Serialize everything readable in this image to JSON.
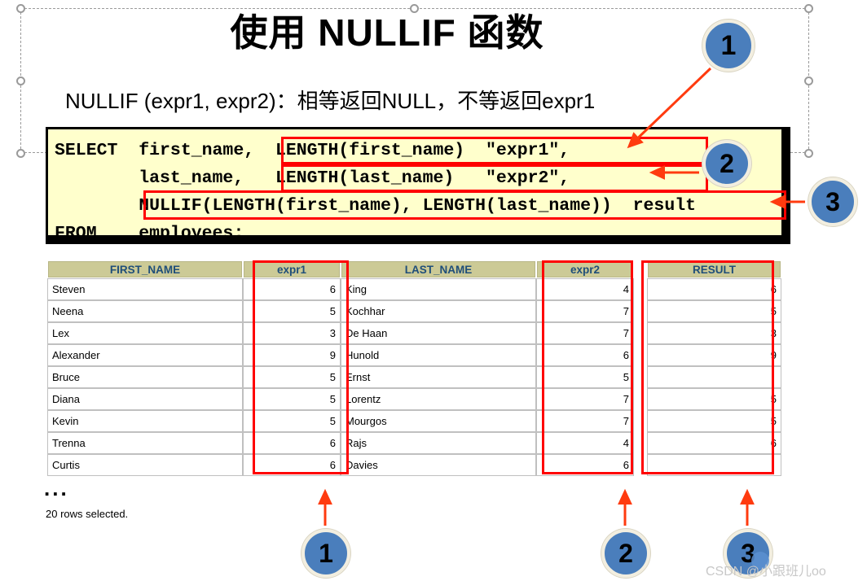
{
  "slide": {
    "title": "使用 NULLIF 函数",
    "subtitle": "NULLIF (expr1, expr2)：相等返回NULL，不等返回expr1"
  },
  "code": {
    "line1": "SELECT  first_name,  LENGTH(first_name)  \"expr1\",",
    "line2": "        last_name,   LENGTH(last_name)   \"expr2\",",
    "line3": "        NULLIF(LENGTH(first_name), LENGTH(last_name))  result",
    "line4": "FROM    employees;"
  },
  "callouts": {
    "top_1": "1",
    "code_2": "2",
    "code_3": "3",
    "bottom_1": "1",
    "bottom_2": "2",
    "bottom_3": "3"
  },
  "table": {
    "headers": [
      "FIRST_NAME",
      "expr1",
      "LAST_NAME",
      "expr2",
      "RESULT"
    ],
    "rows": [
      {
        "first_name": "Steven",
        "expr1": "6",
        "last_name": "King",
        "expr2": "4",
        "result": "6"
      },
      {
        "first_name": "Neena",
        "expr1": "5",
        "last_name": "Kochhar",
        "expr2": "7",
        "result": "5"
      },
      {
        "first_name": "Lex",
        "expr1": "3",
        "last_name": "De Haan",
        "expr2": "7",
        "result": "3"
      },
      {
        "first_name": "Alexander",
        "expr1": "9",
        "last_name": "Hunold",
        "expr2": "6",
        "result": "9"
      },
      {
        "first_name": "Bruce",
        "expr1": "5",
        "last_name": "Ernst",
        "expr2": "5",
        "result": ""
      },
      {
        "first_name": "Diana",
        "expr1": "5",
        "last_name": "Lorentz",
        "expr2": "7",
        "result": "5"
      },
      {
        "first_name": "Kevin",
        "expr1": "5",
        "last_name": "Mourgos",
        "expr2": "7",
        "result": "5"
      },
      {
        "first_name": "Trenna",
        "expr1": "6",
        "last_name": "Rajs",
        "expr2": "4",
        "result": "6"
      },
      {
        "first_name": "Curtis",
        "expr1": "6",
        "last_name": "Davies",
        "expr2": "6",
        "result": ""
      }
    ]
  },
  "footer": {
    "ellipsis": "...",
    "rows_selected": "20 rows selected."
  },
  "watermark": {
    "text": "CSDN @小跟班儿oo"
  },
  "colors": {
    "badge_blue": "#4a7ebc",
    "badge_ring": "#f2eee0",
    "highlight_red": "#ff0000",
    "code_bg": "#ffffcc",
    "table_header_bg": "#ccca96",
    "table_header_text": "#1f4e79"
  }
}
